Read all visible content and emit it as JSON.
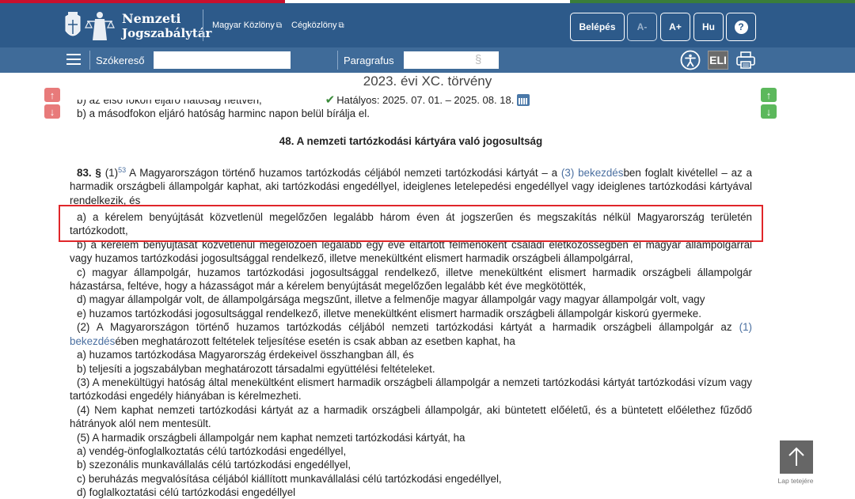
{
  "header": {
    "logo_line1": "Nemzeti",
    "logo_line2": "Jogszabálytár",
    "links": [
      {
        "label": "Magyar Közlöny"
      },
      {
        "label": "Cégközlöny"
      }
    ],
    "buttons": {
      "login": "Belépés",
      "font_smaller": "A-",
      "font_larger": "A+",
      "language": "Hu",
      "help": "?"
    }
  },
  "toolbar": {
    "keyword_label": "Szókereső",
    "keyword_value": "",
    "paragraph_label": "Paragrafus",
    "paragraph_value": "",
    "paragraph_symbol": "§",
    "eli_label": "ELI"
  },
  "document": {
    "title": "2023. évi XC. törvény",
    "status": "Hatályos: 2025. 07. 01. – 2025. 08. 18.",
    "clipped_line": "b) az első fokon eljáró hatóság nettven,",
    "line_prev_b": "b) a másodfokon eljáró hatóság harminc napon belül bírálja el.",
    "section_title": "48. A nemzeti tartózkodási kártyára való jogosultság",
    "p83_num": "83. §",
    "p83_sub": "(1)",
    "p83_ref": "53",
    "p83_text1": " A Magyarországon történő huzamos tartózkodás céljából nemzeti tartózkodási kártyát – a ",
    "p83_link": "(3) bekezdés",
    "p83_text2": "ben foglalt kivétellel – az a harmadik országbeli állampolgár kaphat, aki tartózkodási engedéllyel, ideiglenes letelepedési engedéllyel vagy ideiglenes tartózkodási kártyával rendelkezik, és",
    "item_a": "a) a kérelem benyújtását közvetlenül megelőzően legalább három éven át jogszerűen és megszakítás nélkül Magyarország területén tartózkodott,",
    "item_b": "b) a kérelem benyújtását közvetlenül megelőzően legalább egy éve eltartott felmenőként családi életközösségben él magyar állampolgárral vagy huzamos tartózkodási jogosultsággal rendelkező, illetve menekültként elismert harmadik országbeli állampolgárral,",
    "item_c": "c) magyar állampolgár, huzamos tartózkodási jogosultsággal rendelkező, illetve menekültként elismert harmadik országbeli állampolgár házastársa, feltéve, hogy a házasságot már a kérelem benyújtását megelőzően legalább két éve megkötötték,",
    "item_d": "d) magyar állampolgár volt, de állampolgársága megszűnt, illetve a felmenője magyar állampolgár vagy magyar állampolgár volt, vagy",
    "item_e": "e) huzamos tartózkodási jogosultsággal rendelkező, illetve menekültként elismert harmadik országbeli állampolgár kiskorú gyermeke.",
    "p2_text1": "(2) A Magyarországon történő huzamos tartózkodás céljából nemzeti tartózkodási kártyát a harmadik országbeli állampolgár az ",
    "p2_link": "(1) bekezdés",
    "p2_text2": "ében meghatározott feltételek teljesítése esetén is csak abban az esetben kaphat, ha",
    "p2_a": "a) huzamos tartózkodása Magyarország érdekeivel összhangban áll, és",
    "p2_b": "b) teljesíti a jogszabályban meghatározott társadalmi együttélési feltételeket.",
    "p3": "(3) A menekültügyi hatóság által menekültként elismert harmadik országbeli állampolgár a nemzeti tartózkodási kártyát tartózkodási vízum vagy tartózkodási engedély hiányában is kérelmezheti.",
    "p4": "(4) Nem kaphat nemzeti tartózkodási kártyát az a harmadik országbeli állampolgár, aki büntetett előéletű, és a büntetett előélethez fűződő hátrányok alól nem mentesült.",
    "p5": "(5) A harmadik országbeli állampolgár nem kaphat nemzeti tartózkodási kártyát, ha",
    "p5_a": "a) vendég-önfoglalkoztatás célú tartózkodási engedéllyel,",
    "p5_b": "b) szezonális munkavállalás célú tartózkodási engedéllyel,",
    "p5_c": "c) beruházás megvalósítása céljából kiállított munkavállalási célú tartózkodási engedéllyel,",
    "p5_d": "d) foglalkoztatási célú tartózkodási engedéllyel"
  },
  "back_to_top_label": "Lap tetejére",
  "colors": {
    "header_bg": "#2d5a8a",
    "toolbar_bg": "#3f6b99",
    "highlight": "#e0262a",
    "link": "#4a6fa0"
  }
}
